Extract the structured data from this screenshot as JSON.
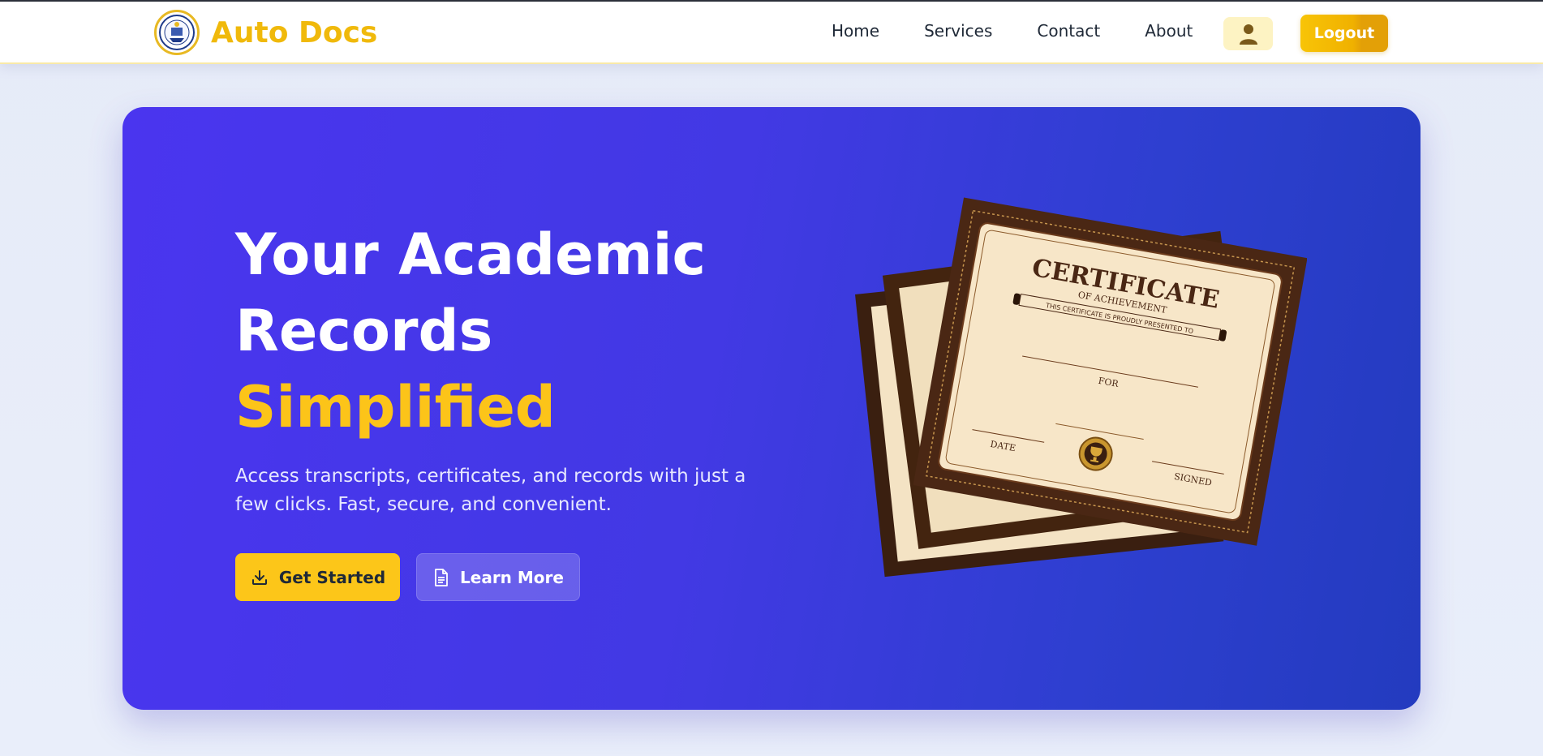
{
  "header": {
    "brand_name": "Auto Docs",
    "nav": [
      "Home",
      "Services",
      "Contact",
      "About"
    ],
    "logout_label": "Logout"
  },
  "hero": {
    "title_line1": "Your Academic",
    "title_line2": "Records",
    "title_accent": "Simplified",
    "description": "Access transcripts, certificates, and records with just a few clicks. Fast, secure, and convenient.",
    "primary_button": "Get Started",
    "secondary_button": "Learn More"
  },
  "certificate": {
    "heading": "CERTIFICATE",
    "subheading": "OF ACHIEVEMENT",
    "presented": "THIS CERTIFICATE IS PROUDLY PRESENTED TO",
    "for_label": "FOR",
    "date_label": "DATE",
    "signed_label": "SIGNED"
  },
  "colors": {
    "brand": "#f0b90b",
    "accent": "#fcc419",
    "hero_start": "#4a35ef",
    "hero_end": "#233bbf"
  },
  "icons": [
    "user-icon",
    "download-icon",
    "document-icon",
    "university-seal-logo"
  ]
}
